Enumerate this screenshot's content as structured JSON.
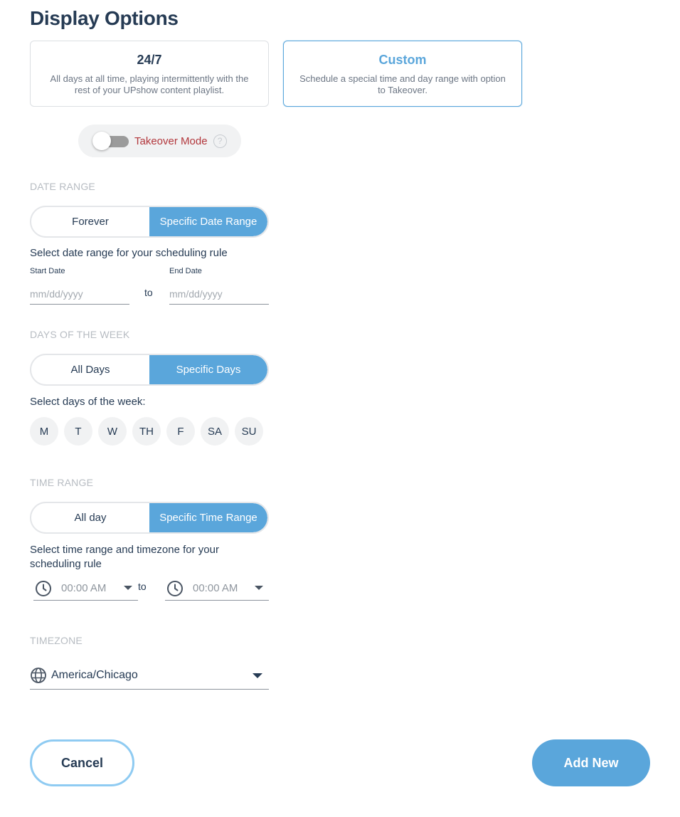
{
  "page": {
    "title": "Display Options"
  },
  "modes": [
    {
      "title": "24/7",
      "description": "All days at all time, playing intermittently with the rest of your UPshow content playlist."
    },
    {
      "title": "Custom",
      "description": "Schedule a special time and day range with option to Takeover."
    }
  ],
  "takeover": {
    "label": "Takeover Mode",
    "help": "?",
    "enabled": false
  },
  "date_range": {
    "section": "DATE RANGE",
    "options": [
      "Forever",
      "Specific Date Range"
    ],
    "selected": "Specific Date Range",
    "hint": "Select date range for your scheduling rule",
    "start_label": "Start Date",
    "end_label": "End Date",
    "start_placeholder": "mm/dd/yyyy",
    "end_placeholder": "mm/dd/yyyy",
    "to": "to"
  },
  "days_of_week": {
    "section": "DAYS OF THE WEEK",
    "options": [
      "All Days",
      "Specific Days"
    ],
    "selected": "Specific Days",
    "hint": "Select days of the week:",
    "days": [
      "M",
      "T",
      "W",
      "TH",
      "F",
      "SA",
      "SU"
    ]
  },
  "time_range": {
    "section": "TIME RANGE",
    "options": [
      "All day",
      "Specific Time Range"
    ],
    "selected": "Specific Time Range",
    "hint": "Select time range and timezone for your scheduling rule",
    "start": "00:00 AM",
    "end": "00:00 AM",
    "to": "to"
  },
  "timezone": {
    "section": "TIMEZONE",
    "value": "America/Chicago"
  },
  "actions": {
    "cancel": "Cancel",
    "add": "Add New"
  },
  "colors": {
    "accent": "#5aa6db",
    "text": "#263b54",
    "takeover": "#b2373c",
    "muted": "#b7bcc2"
  },
  "icons": {
    "help": "question-circle-icon",
    "clock": "clock-icon",
    "globe": "globe-icon",
    "dropdown": "caret-down-icon"
  }
}
